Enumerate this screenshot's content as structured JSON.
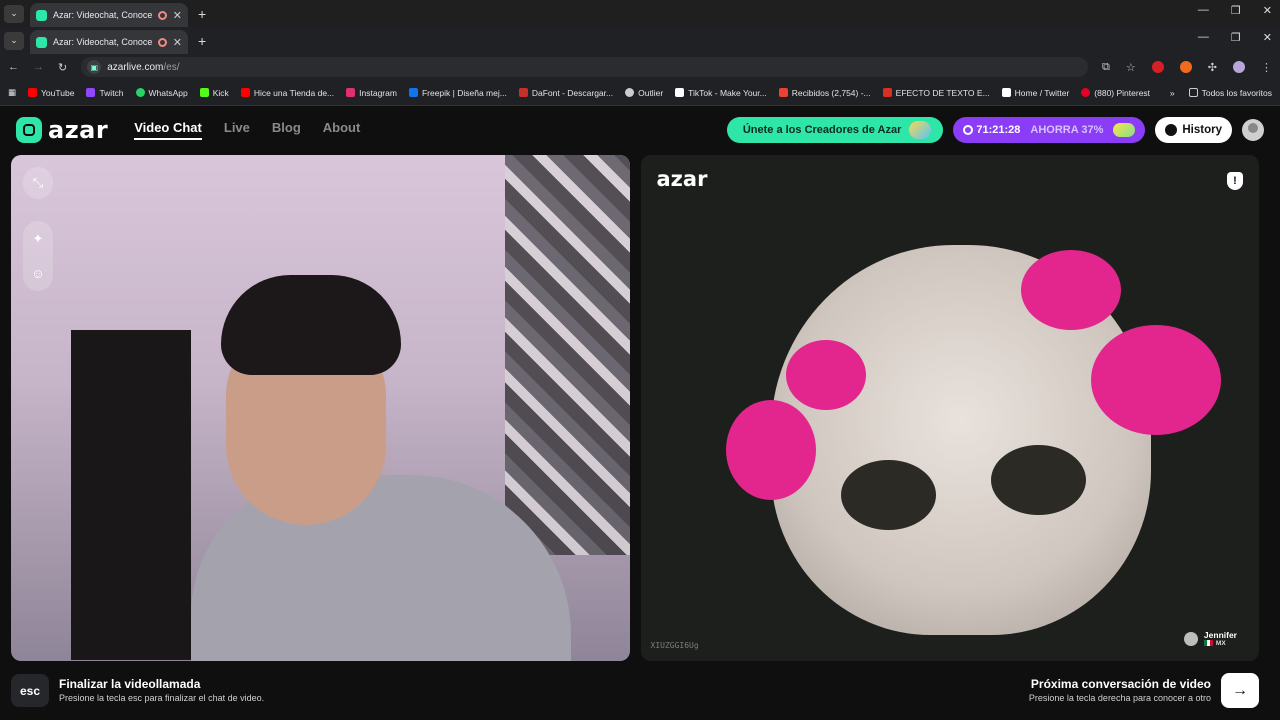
{
  "browser": {
    "tabs": [
      {
        "title": "Azar: Videochat, Conoce Ar"
      },
      {
        "title": "Azar: Videochat, Conoce Ar"
      }
    ],
    "url_host": "azarlive.com",
    "url_path": "/es/",
    "bookmarks": [
      {
        "label": "YouTube",
        "color": "#ff0000"
      },
      {
        "label": "Twitch",
        "color": "#9146ff"
      },
      {
        "label": "WhatsApp",
        "color": "#25d366"
      },
      {
        "label": "Kick",
        "color": "#53fc18"
      },
      {
        "label": "Hice una Tienda de...",
        "color": "#ff0000"
      },
      {
        "label": "Instagram",
        "color": "#e1306c"
      },
      {
        "label": "Freepik | Diseña mej...",
        "color": "#1273eb"
      },
      {
        "label": "DaFont - Descargar...",
        "color": "#c4302b"
      },
      {
        "label": "Outlier",
        "color": "#cccccc"
      },
      {
        "label": "TikTok - Make Your...",
        "color": "#ffffff"
      },
      {
        "label": "Recibidos (2,754) -...",
        "color": "#ea4335"
      },
      {
        "label": "EFECTO DE TEXTO E...",
        "color": "#d93025"
      },
      {
        "label": "Home / Twitter",
        "color": "#ffffff"
      },
      {
        "label": "(880) Pinterest",
        "color": "#e60023"
      }
    ],
    "all_bookmarks": "Todos los favoritos"
  },
  "header": {
    "logo": "azar",
    "nav": [
      "Video Chat",
      "Live",
      "Blog",
      "About"
    ],
    "creators_label": "Únete a los Creadores de Azar",
    "timer": "71:21:28",
    "save_label": "AHORRA 37%",
    "history_label": "History"
  },
  "video": {
    "remote_logo": "azar",
    "peer_id": "XIUZGGI6Ug",
    "peer_name": "Jennifer",
    "peer_country": "MX"
  },
  "footer": {
    "esc_key": "esc",
    "end_title": "Finalizar la videollamada",
    "end_desc": "Presione la tecla esc para finalizar el chat de video.",
    "next_title": "Próxima conversación de video",
    "next_desc": "Presione la tecla derecha para conocer a otro"
  },
  "colors": {
    "brand": "#2ee6a8",
    "promo": "#8b3cf7"
  }
}
